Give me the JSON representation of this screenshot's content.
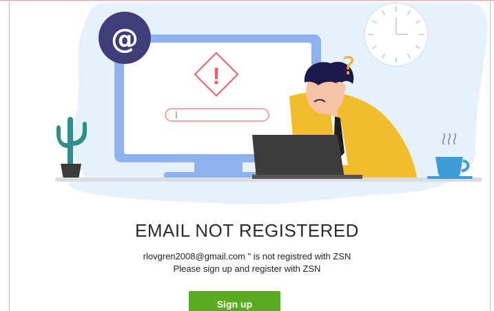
{
  "page": {
    "heading": "EMAIL NOT REGISTERED",
    "message_line_1": "rlovgren2008@gmail.com \" is not registred with ZSN",
    "message_line_2": "Please sign up and register with ZSN",
    "signup_label": "Sign up"
  },
  "illustration": {
    "at_symbol": "@",
    "warning_symbol": "!",
    "question_symbol": "?",
    "icons": [
      "at-sign-icon",
      "warning-icon",
      "clock-icon",
      "cactus-icon",
      "coffee-cup-icon",
      "laptop-icon",
      "monitor-icon",
      "confused-person-icon"
    ]
  },
  "colors": {
    "blob": "#e7f1fb",
    "monitor_frame": "#8fb2ee",
    "at_badge": "#3f3d7a",
    "warning": "#ee5d5d",
    "person_shirt": "#f2bd2c",
    "question": "#f2a93b",
    "button": "#5aab1f",
    "cup": "#3e9bd6",
    "cactus": "#2e8f8a"
  }
}
